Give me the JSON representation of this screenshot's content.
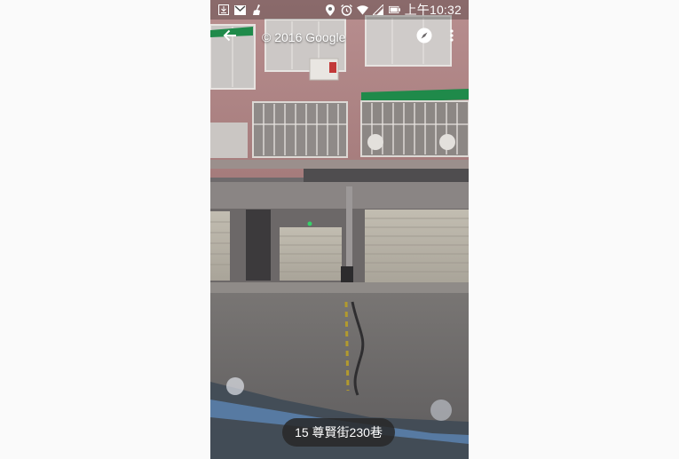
{
  "status_bar": {
    "time": "上午10:32",
    "left_icons": [
      "download-notification-icon",
      "gmail-icon",
      "clean-icon"
    ],
    "right_icons": [
      "location-icon",
      "alarm-icon",
      "wifi-icon",
      "signal-icon",
      "battery-icon"
    ]
  },
  "app_bar": {
    "copyright": "© 2016 Google",
    "back_icon": "arrow-back-icon",
    "compass_icon": "compass-icon",
    "menu_icon": "more-vert-icon"
  },
  "address": {
    "label": "15 尊賢街230巷"
  },
  "colors": {
    "status_overlay": "#000000",
    "awning_green": "#1f8a4a",
    "building_pink": "#b58f8f",
    "shutter": "#b9b4a8",
    "pill_bg": "#2a2a2a"
  }
}
